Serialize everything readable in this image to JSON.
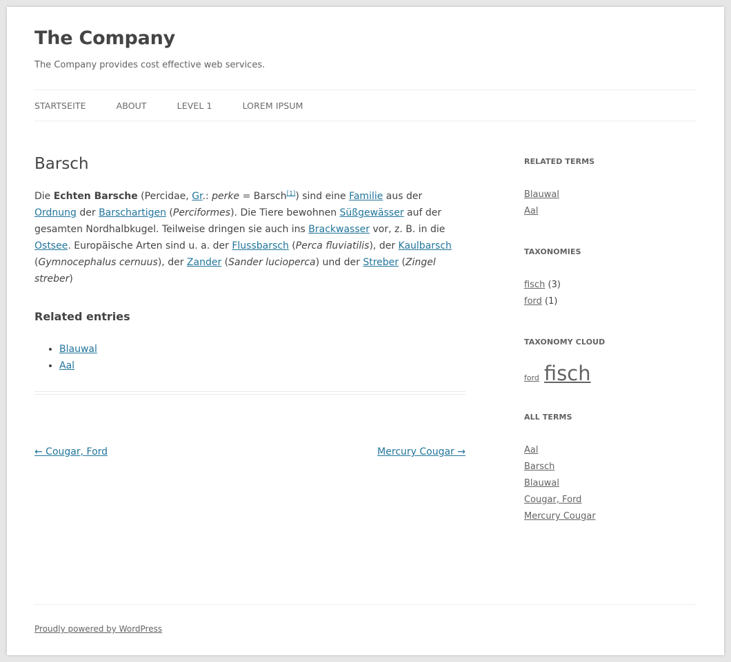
{
  "header": {
    "site_title": "The Company",
    "tagline": "The Company provides cost effective web services."
  },
  "nav": [
    "STARTSEITE",
    "ABOUT",
    "LEVEL 1",
    "LOREM IPSUM"
  ],
  "post": {
    "title": "Barsch",
    "content": {
      "t1": "Die ",
      "b1": "Echten Barsche",
      "t2": " (Percidae, ",
      "l_gr": "Gr",
      "t3": ".: ",
      "i_perke": "perke",
      "t4": " = Barsch",
      "sup": "[1]",
      "t5": ") sind eine ",
      "l_familie": "Familie",
      "t6": " aus der ",
      "l_ordnung": "Ordnung",
      "t7": " der ",
      "l_barschartigen": "Barschartigen",
      "t8": " (",
      "i_perciformes": "Perciformes",
      "t9": "). Die Tiere bewohnen ",
      "l_suess": "Süßgewässer",
      "t10": " auf der gesamten Nordhalbkugel. Teilweise dringen sie auch ins ",
      "l_brack": "Brackwasser",
      "t11": " vor, z. B. in die ",
      "l_ostsee": "Ostsee",
      "t12": ". Europäische Arten sind u. a. der ",
      "l_fluss": "Flussbarsch",
      "t13": " (",
      "i_perca": "Perca fluviatilis",
      "t14": "), der ",
      "l_kaul": "Kaulbarsch",
      "t15": " (",
      "i_gymno": "Gymnocephalus cernuus",
      "t16": "), der ",
      "l_zander": "Zander",
      "t17": " (",
      "i_sander": "Sander lucioperca",
      "t18": ") und der ",
      "l_streber": "Streber",
      "t19": " (",
      "i_zingel": "Zingel streber",
      "t20": ")"
    },
    "related_heading": "Related entries",
    "related": [
      "Blauwal",
      "Aal"
    ]
  },
  "post_nav": {
    "prev": "← Cougar, Ford",
    "next": "Mercury Cougar →"
  },
  "sidebar": {
    "related_terms": {
      "title": "RELATED TERMS",
      "items": [
        "Blauwal",
        "Aal"
      ]
    },
    "taxonomies": {
      "title": "TAXONOMIES",
      "items": [
        {
          "name": "fisch",
          "count": "(3)"
        },
        {
          "name": "ford",
          "count": "(1)"
        }
      ]
    },
    "taxonomy_cloud": {
      "title": "TAXONOMY CLOUD",
      "items": [
        "ford",
        "fisch"
      ]
    },
    "all_terms": {
      "title": "ALL TERMS",
      "items": [
        "Aal",
        "Barsch",
        "Blauwal",
        "Cougar, Ford",
        "Mercury Cougar"
      ]
    }
  },
  "footer": {
    "text": "Proudly powered by WordPress"
  },
  "colors": {
    "link": "#21759b",
    "text": "#444444",
    "muted": "#636363",
    "background": "#e6e6e6"
  }
}
